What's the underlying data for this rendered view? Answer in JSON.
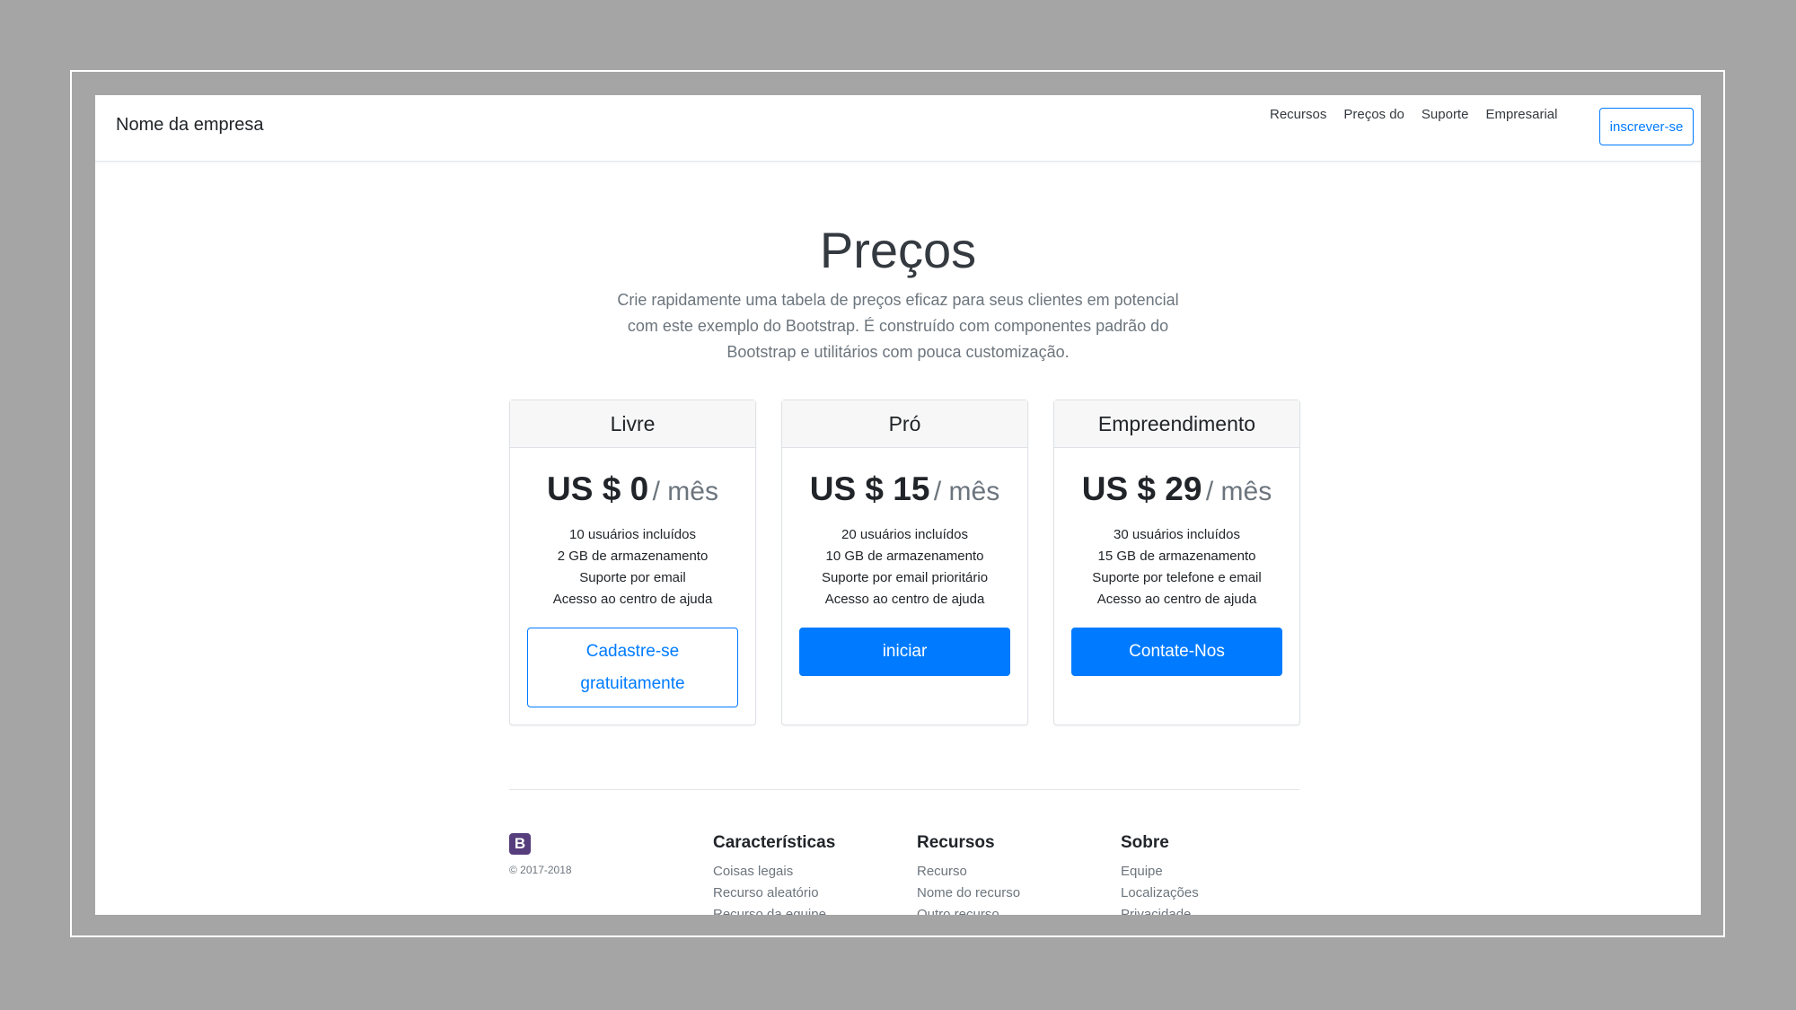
{
  "navbar": {
    "brand": "Nome da empresa",
    "links": [
      "Recursos",
      "Preços do",
      "Suporte",
      "Empresarial"
    ],
    "signup_label": "inscrever-se"
  },
  "hero": {
    "title": "Preços",
    "lead": "Crie rapidamente uma tabela de preços eficaz para seus clientes em potencial com este exemplo do Bootstrap. É construído com componentes padrão do Bootstrap e utilitários com pouca customização."
  },
  "plans": [
    {
      "name": "Livre",
      "price": "US $ 0",
      "period": "/ mês",
      "features": [
        "10 usuários incluídos",
        "2 GB de armazenamento",
        "Suporte por email",
        "Acesso ao centro de ajuda"
      ],
      "button": "Cadastre-se gratuitamente"
    },
    {
      "name": "Pró",
      "price": "US $ 15",
      "period": "/ mês",
      "features": [
        "20 usuários incluídos",
        "10 GB de armazenamento",
        "Suporte por email prioritário",
        "Acesso ao centro de ajuda"
      ],
      "button": "iniciar"
    },
    {
      "name": "Empreendimento",
      "price": "US $ 29",
      "period": "/ mês",
      "features": [
        "30 usuários incluídos",
        "15 GB de armazenamento",
        "Suporte por telefone e email",
        "Acesso ao centro de ajuda"
      ],
      "button": "Contate-Nos"
    }
  ],
  "footer": {
    "logo_letter": "B",
    "copyright": "© 2017-2018",
    "columns": [
      {
        "title": "Características",
        "items": [
          "Coisas legais",
          "Recurso aleatório",
          "Recurso da equipe"
        ]
      },
      {
        "title": "Recursos",
        "items": [
          "Recurso",
          "Nome do recurso",
          "Outro recurso"
        ]
      },
      {
        "title": "Sobre",
        "items": [
          "Equipe",
          "Localizações",
          "Privacidade"
        ]
      }
    ]
  },
  "colors": {
    "primary": "#007bff",
    "frame_background": "#a5a5a5",
    "logo_purple": "#563d7c"
  }
}
